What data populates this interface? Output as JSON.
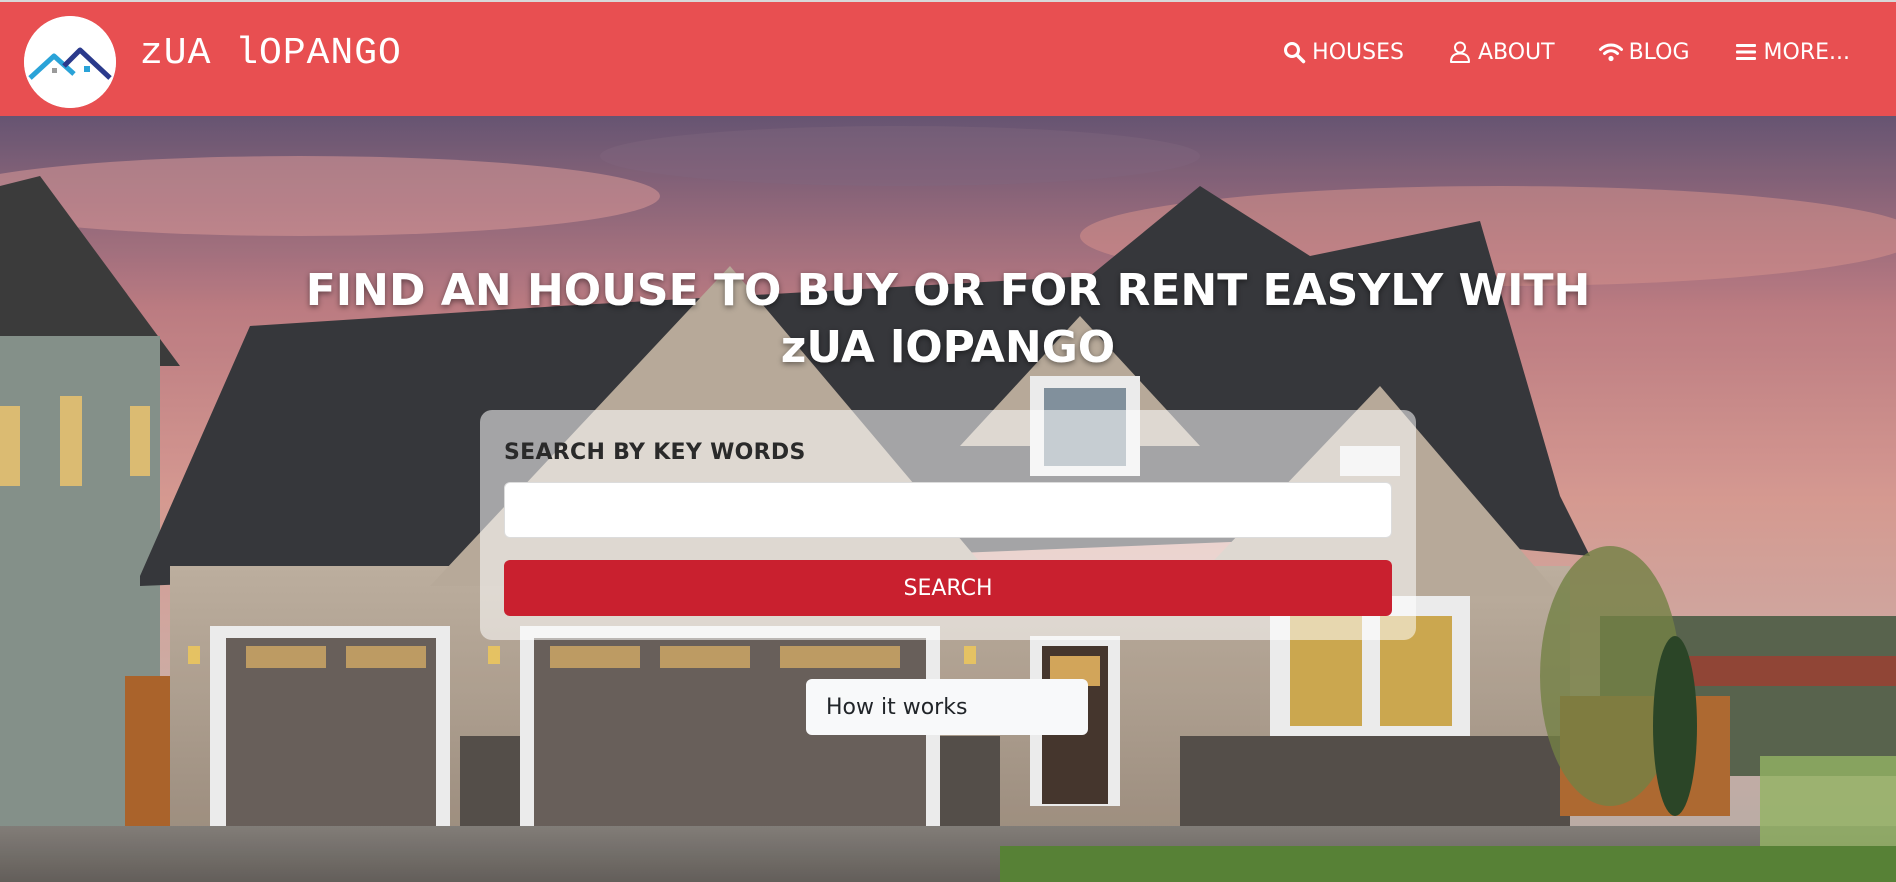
{
  "brand": {
    "name": "zUA lOPANGO",
    "logo_icon": "house-roof-logo"
  },
  "nav": {
    "items": [
      {
        "icon": "search-icon",
        "label": "HOUSES"
      },
      {
        "icon": "user-icon",
        "label": "ABOUT"
      },
      {
        "icon": "wifi-icon",
        "label": "BLOG"
      },
      {
        "icon": "menu-icon",
        "label": "MORE..."
      }
    ]
  },
  "hero": {
    "title": "FIND AN HOUSE TO BUY OR FOR RENT EASYLY WITH zUA lOPANGO",
    "search": {
      "label": "SEARCH BY KEY WORDS",
      "value": "",
      "placeholder": "",
      "button_label": "SEARCH"
    },
    "how_it_works_label": "How it works"
  },
  "colors": {
    "navbar": "#e84f51",
    "search_button": "#c9202f",
    "brand_text": "#ffffff"
  }
}
